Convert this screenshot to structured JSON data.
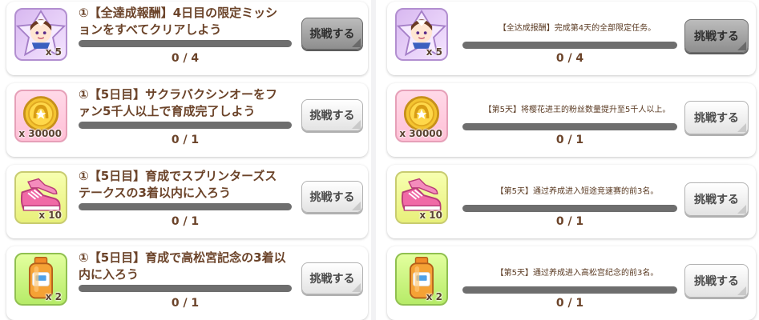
{
  "left": {
    "missions": [
      {
        "title": "①【全達成報酬】4日目の限定ミッションをすべてクリアしよう",
        "reward": "x 5",
        "progress": "0 / 4",
        "progress_value": 0,
        "button": "挑戦する",
        "icon": "ribbon-character-icon"
      },
      {
        "title": "①【5日目】サクラバクシンオーをファン5千人以上で育成完了しよう",
        "reward": "x 30000",
        "progress": "0 / 1",
        "progress_value": 0,
        "button": "挑戦する",
        "icon": "gold-coin-icon"
      },
      {
        "title": "①【5日目】育成でスプリンターズステークスの3着以内に入ろう",
        "reward": "x 10",
        "progress": "0 / 1",
        "progress_value": 0,
        "button": "挑戦する",
        "icon": "pink-shoes-icon"
      },
      {
        "title": "①【5日目】育成で高松宮記念の3着以内に入ろう",
        "reward": "x 2",
        "progress": "0 / 1",
        "progress_value": 0,
        "button": "挑戦する",
        "icon": "tp-bottle-icon"
      }
    ]
  },
  "right": {
    "missions": [
      {
        "desc": "【全达成报酬】完成第4天的全部限定任务。",
        "reward": "x 5",
        "progress": "0 / 4",
        "progress_value": 0,
        "button": "挑戦する",
        "icon": "ribbon-character-icon"
      },
      {
        "desc": "【第5天】将樱花进王的粉丝数量提升至5千人以上。",
        "reward": "x 30000",
        "progress": "0 / 1",
        "progress_value": 0,
        "button": "挑戦する",
        "icon": "gold-coin-icon"
      },
      {
        "desc": "【第5天】通过养成进入短途竞速赛的前3名。",
        "reward": "x 10",
        "progress": "0 / 1",
        "progress_value": 0,
        "button": "挑戦する",
        "icon": "pink-shoes-icon"
      },
      {
        "desc": "【第5天】通过养成进入高松宫纪念的前3名。",
        "reward": "x 2",
        "progress": "0 / 1",
        "progress_value": 0,
        "button": "挑戦する",
        "icon": "tp-bottle-icon"
      }
    ]
  },
  "colors": {
    "text_brown": "#6b4329",
    "bar_track": "#6e6e6e",
    "bar_fill": "#f7a93a",
    "card_bg": "#ffffff",
    "page_bg": "#f2f2f4"
  }
}
